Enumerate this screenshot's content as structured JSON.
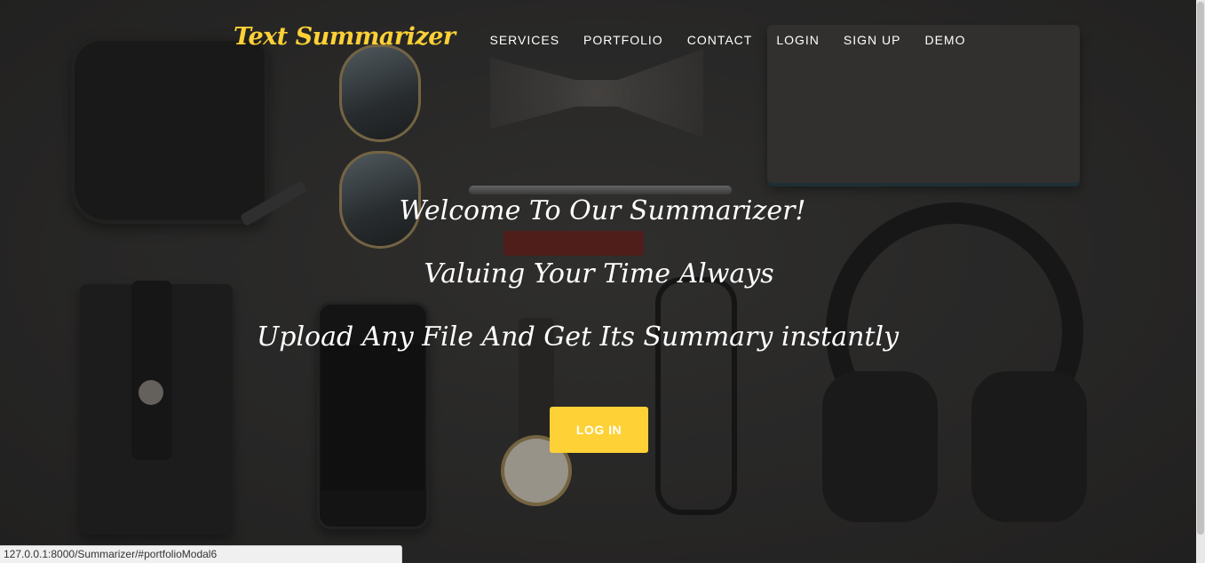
{
  "nav": {
    "brand": "Text Summarizer",
    "items": [
      {
        "label": "SERVICES"
      },
      {
        "label": "PORTFOLIO"
      },
      {
        "label": "CONTACT"
      },
      {
        "label": "LOGIN"
      },
      {
        "label": "SIGN UP"
      },
      {
        "label": "DEMO"
      }
    ]
  },
  "hero": {
    "line1": "Welcome To Our Summarizer!",
    "line2": "Valuing Your Time Always",
    "line3": "Upload Any File And Get Its Summary instantly",
    "button_label": "LOG IN"
  },
  "status_bar": {
    "url": "127.0.0.1:8000/Summarizer/#portfolioModal6"
  },
  "colors": {
    "accent": "#fed136",
    "text": "#ffffff"
  }
}
